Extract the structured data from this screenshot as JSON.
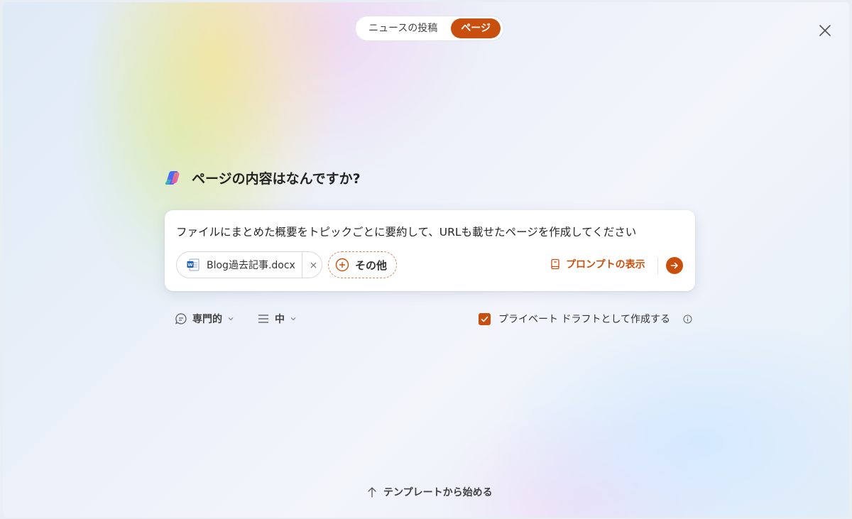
{
  "tabs": {
    "news_post": "ニュースの投稿",
    "page": "ページ",
    "selected": "ページ"
  },
  "heading": "ページの内容はなんですか?",
  "prompt": {
    "text": "ファイルにまとめた概要をトピックごとに要約して、URLも載せたページを作成してください",
    "attachment": "Blog過去記事.docx",
    "more_label": "その他",
    "show_prompt_label": "プロンプトの表示"
  },
  "options": {
    "tone_label": "専門的",
    "length_label": "中",
    "private_draft_label": "プライベート ドラフトとして作成する",
    "private_draft_checked": true
  },
  "template_link": "テンプレートから始める",
  "colors": {
    "accent": "#c94f0f",
    "word_blue": "#185abd"
  },
  "icons": [
    "copilot-icon",
    "close-icon",
    "word-doc-icon",
    "plus-circle-icon",
    "prompt-book-icon",
    "arrow-right-icon",
    "chat-bubble-icon",
    "lines-icon",
    "chevron-down-icon",
    "checkmark-icon",
    "info-icon",
    "arrow-up-icon"
  ]
}
